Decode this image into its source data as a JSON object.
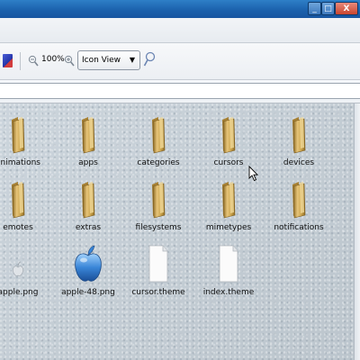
{
  "window": {
    "minimize_glyph": "_",
    "maximize_glyph": "□",
    "close_glyph": "X"
  },
  "toolbar": {
    "zoom_level": "100%",
    "view_mode": "Icon View"
  },
  "files": [
    {
      "name": "animations",
      "kind": "folder"
    },
    {
      "name": "apps",
      "kind": "folder"
    },
    {
      "name": "categories",
      "kind": "folder"
    },
    {
      "name": "cursors",
      "kind": "folder"
    },
    {
      "name": "devices",
      "kind": "folder"
    },
    {
      "name": "emotes",
      "kind": "folder"
    },
    {
      "name": "extras",
      "kind": "folder"
    },
    {
      "name": "filesystems",
      "kind": "folder"
    },
    {
      "name": "mimetypes",
      "kind": "folder"
    },
    {
      "name": "notifications",
      "kind": "folder"
    },
    {
      "name": "apple.png",
      "kind": "image-small"
    },
    {
      "name": "apple-48.png",
      "kind": "image-apple"
    },
    {
      "name": "cursor.theme",
      "kind": "document"
    },
    {
      "name": "index.theme",
      "kind": "document"
    }
  ],
  "colors": {
    "titlebar": "#1c62ad",
    "folder": "#c9a24a",
    "apple_blue": "#3a86d8"
  }
}
